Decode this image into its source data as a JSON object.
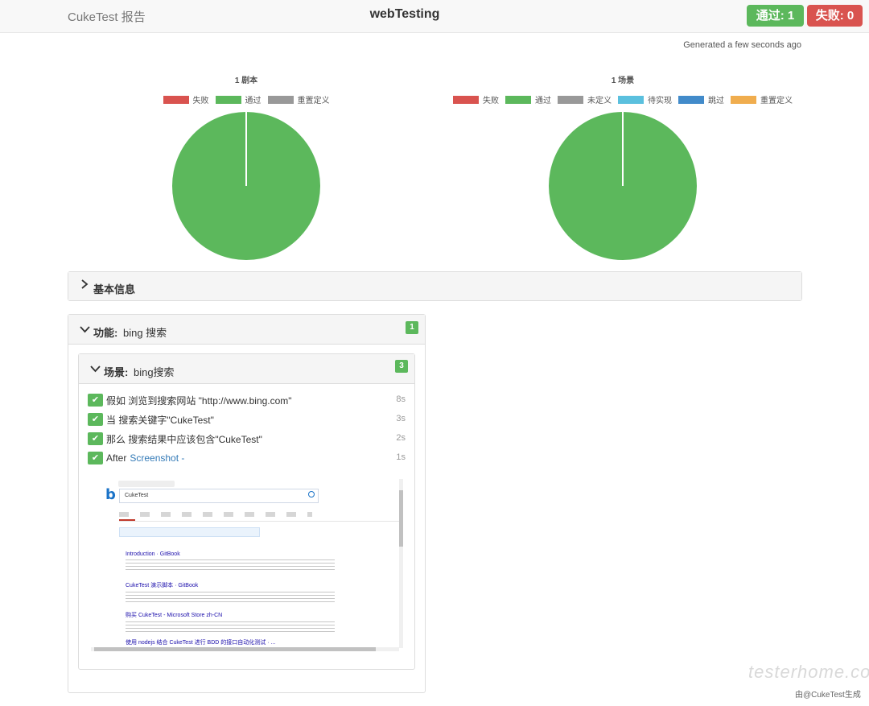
{
  "navbar": {
    "brand": "CukeTest 报告",
    "title": "webTesting",
    "passed_label": "通过: 1",
    "failed_label": "失败: 0"
  },
  "generated": "Generated a few seconds ago",
  "chart_data": [
    {
      "type": "pie",
      "title": "1 剧本",
      "categories": [
        "失败",
        "通过",
        "重置定义"
      ],
      "values": [
        0,
        1,
        0
      ],
      "colors": [
        "#d9534f",
        "#5cb85c",
        "#999999"
      ]
    },
    {
      "type": "pie",
      "title": "1 场景",
      "categories": [
        "失败",
        "通过",
        "未定义",
        "待实现",
        "跳过",
        "重置定义"
      ],
      "values": [
        0,
        1,
        0,
        0,
        0,
        0
      ],
      "colors": [
        "#d9534f",
        "#5cb85c",
        "#999999",
        "#5bc0de",
        "#428bca",
        "#f0ad4e"
      ]
    }
  ],
  "basic_info": {
    "label": "基本信息"
  },
  "feature": {
    "label": "功能:",
    "name": "bing 搜索",
    "count": "1",
    "scenario": {
      "label": "场景:",
      "name": "bing搜索",
      "count": "3",
      "steps": [
        {
          "text": "假如 浏览到搜索网站 \"http://www.bing.com\"",
          "duration": "8s"
        },
        {
          "text": "当 搜索关键字\"CukeTest\"",
          "duration": "3s"
        },
        {
          "text": "那么 搜索结果中应该包含\"CukeTest\"",
          "duration": "2s"
        }
      ],
      "after": {
        "label": "After",
        "link": "Screenshot -",
        "duration": "1s"
      }
    }
  },
  "screenshot": {
    "search_value": "CukeTest",
    "results": [
      {
        "title": "Introduction · GitBook"
      },
      {
        "title": "CukeTest 演示脚本 · GitBook"
      },
      {
        "title": "购买 CukeTest - Microsoft Store zh-CN"
      },
      {
        "title": "使用 nodejs 结合 CukeTest 进行 BDD 的接口自动化测试 · ..."
      }
    ]
  },
  "watermark": {
    "text": "testerhome.com",
    "footer": "由@CukeTest生成"
  }
}
